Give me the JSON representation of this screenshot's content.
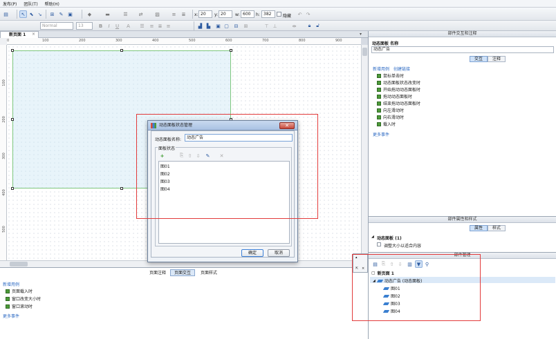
{
  "menu": {
    "items": [
      "发布(P)",
      "团队(T)",
      "帮助(H)"
    ]
  },
  "toolbar": {
    "font": "Normal",
    "size": "13",
    "x_label": "x:",
    "x_value": "20",
    "y_label": "y:",
    "y_value": "20",
    "w_label": "w:",
    "w_value": "600",
    "h_label": "h:",
    "h_value": "382",
    "hidden_label": "隐藏"
  },
  "document": {
    "tab_label": "新页面 1"
  },
  "ruler": {
    "h_marks": [
      "0",
      "100",
      "200",
      "300",
      "400",
      "500",
      "600",
      "700",
      "800",
      "900"
    ],
    "v_marks": [
      "100",
      "200",
      "300",
      "400",
      "500"
    ]
  },
  "page_panel": {
    "tabs": [
      "页面注释",
      "页面交互",
      "页面样式"
    ],
    "active_tab": "页面交互",
    "section": "新增用例",
    "events": [
      "页面载入时",
      "窗口改变大小时",
      "窗口滚动时"
    ],
    "more": "更多事件"
  },
  "widget_interactions": {
    "title": "部件交互和注释",
    "name_header": "动态面板 名称",
    "name_value": "动态广告",
    "tabs": [
      "交互",
      "注释"
    ],
    "active_tab": "交互",
    "links": [
      "新增用例",
      "创建链接"
    ],
    "events": [
      "鼠标单击时",
      "动态面板状态改变时",
      "开始拖动动态面板时",
      "拖动动态面板时",
      "结束拖动动态面板时",
      "向左滑动时",
      "向右滑动时",
      "载入时"
    ],
    "more": "更多事件"
  },
  "widget_properties": {
    "title": "部件属性和样式",
    "tabs": [
      "属性",
      "样式"
    ],
    "active_tab": "属性",
    "group": "动态面板 (1)",
    "checkbox": "调整大小以适合内容"
  },
  "widget_manager": {
    "title": "部件管理",
    "tree": {
      "page": "新页面 1",
      "panel": "动态广告 (动态面板)",
      "states": [
        "图01",
        "图02",
        "图03",
        "图04"
      ]
    }
  },
  "dialog": {
    "title": "动态面板状态管理",
    "name_label": "动态面板名称:",
    "name_value": "动态广告",
    "group_label": "面板状态",
    "states": [
      "图01",
      "图02",
      "图03",
      "图04"
    ],
    "ok": "确定",
    "cancel": "取消",
    "close": "✕"
  },
  "colors": {
    "accent": "#2e6bc4",
    "highlight": "#e23a3a",
    "event_icon": "#4e9a3a",
    "panel_border": "#7ec77e"
  }
}
